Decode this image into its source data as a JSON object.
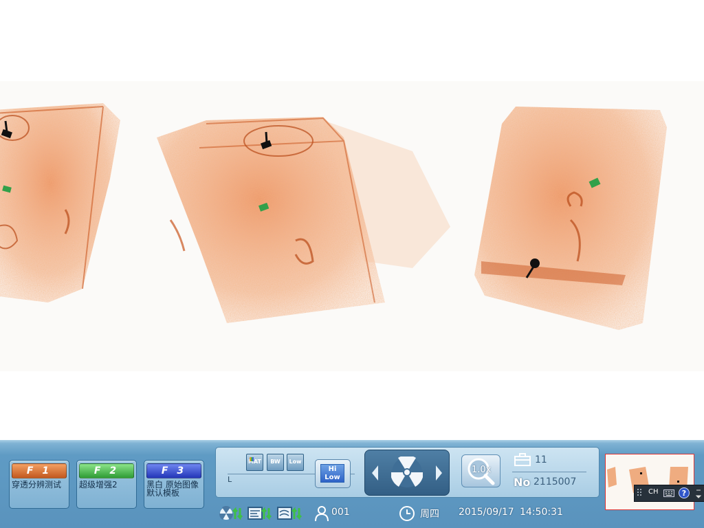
{
  "scan": {
    "bag_color": "#e3692a",
    "threat_color": "#111111",
    "marker_color": "#32a04a"
  },
  "function_keys": [
    {
      "key": "F 1",
      "label": "穿透分辨测试",
      "color": "#e0772f"
    },
    {
      "key": "F 2",
      "label": "超级增强2",
      "color": "#3fae44"
    },
    {
      "key": "F 3",
      "label": "黑白 原始图像 默认模板",
      "color": "#3247d0"
    }
  ],
  "controls": {
    "modes": [
      "MAT",
      "BW",
      "Low"
    ],
    "mode_row_label": "L",
    "hi_low": {
      "hi": "Hi",
      "low": "Low"
    },
    "xray_icon": "radiation-icon",
    "zoom": "1.0x",
    "bag_count": "11",
    "no_label": "No",
    "serial_no": "2115007"
  },
  "status_bar": {
    "operator": "001",
    "weekday": "周四",
    "date": "2015/09/17",
    "time": "14:50:31"
  },
  "ime": {
    "lang": "CH"
  },
  "colors": {
    "taskbar": "#5a93bd",
    "panel": "#bcd9ec",
    "thumb_border": "#dd3333"
  }
}
